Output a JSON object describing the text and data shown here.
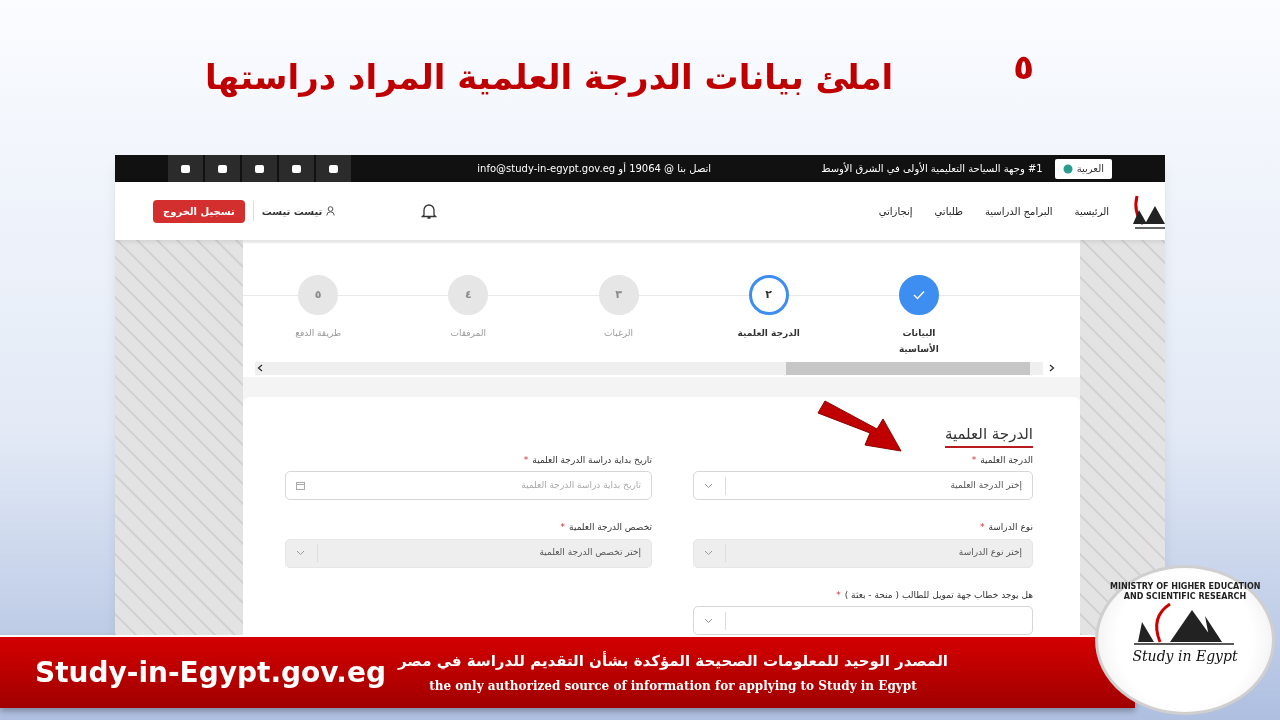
{
  "slide": {
    "step_number": "٥",
    "title": "املئ بيانات الدرجة العلمية المراد دراستها"
  },
  "topbar": {
    "language": "العربية",
    "tagline": "#1 وجهة السياحة التعليمية الأولى في الشرق الأوسط",
    "contact": "اتصل بنا @ 19064 أو info@study-in-egypt.gov.eg"
  },
  "nav": {
    "items": [
      {
        "label": "الرئيسية"
      },
      {
        "label": "البرامج الدراسية"
      },
      {
        "label": "طلباتي"
      },
      {
        "label": "إنجازاتي"
      }
    ],
    "user": "تيست تيست",
    "logout": "تسجيل الخروج"
  },
  "steps": [
    {
      "label": "البيانات الأساسية",
      "completed": true,
      "selected": false
    },
    {
      "number": "٢",
      "label": "الدرجة العلمية",
      "completed": false,
      "selected": true
    },
    {
      "number": "٣",
      "label": "الرغبات",
      "completed": false,
      "selected": false
    },
    {
      "number": "٤",
      "label": "المرفقات",
      "completed": false,
      "selected": false
    },
    {
      "number": "٥",
      "label": "طريقة الدفع",
      "completed": false,
      "selected": false
    }
  ],
  "form": {
    "title": "الدرجة العلمية",
    "fields": [
      {
        "kind": "select",
        "label": "الدرجة العلمية",
        "required_mark": "*",
        "placeholder": "إختر الدرجة العلمية",
        "disabled": false
      },
      {
        "kind": "date",
        "label": "تاريخ بداية دراسة الدرجة العلمية",
        "required_mark": "*",
        "placeholder": "تاريخ بداية دراسة الدرجة العلمية",
        "disabled": false
      },
      {
        "kind": "select",
        "label": "نوع الدراسة",
        "required_mark": "*",
        "placeholder": "إختر نوع الدراسة",
        "disabled": true
      },
      {
        "kind": "select",
        "label": "تخصص الدرجة العلمية",
        "required_mark": "*",
        "placeholder": "إختر تخصص الدرجة العلمية",
        "disabled": true
      },
      {
        "kind": "select",
        "label": "هل يوجد خطاب جهة تمويل للطالب ( منحة - بعثة )",
        "required_mark": "*",
        "disabled": false
      }
    ]
  },
  "banner": {
    "site": "Study-in-Egypt.gov.eg",
    "arabic": "المصدر الوحيد للمعلومات الصحيحة المؤكدة بشأن التقديم للدراسة في مصر",
    "english": "the only authorized source of information for applying to Study in Egypt"
  },
  "badge": {
    "line_1": "MINISTRY OF HIGHER EDUCATION",
    "line_2": "AND SCIENTIFIC RESEARCH",
    "brand": "Study in Egypt"
  }
}
